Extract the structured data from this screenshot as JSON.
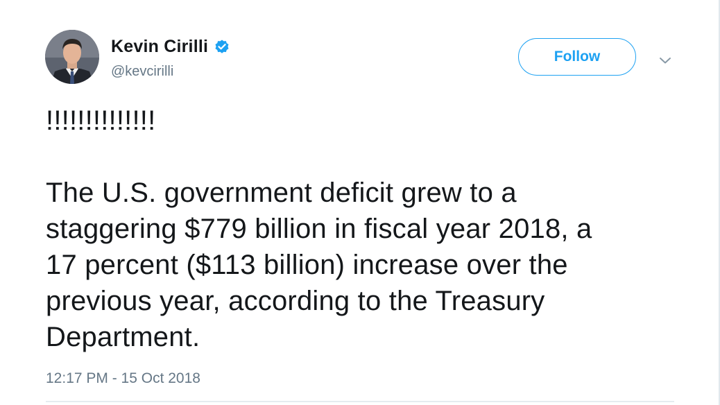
{
  "user": {
    "display_name": "Kevin Cirilli",
    "handle": "@kevcirilli",
    "verified": true
  },
  "actions": {
    "follow_label": "Follow",
    "more_icon": "chevron-down-icon"
  },
  "tweet": {
    "text": "!!!!!!!!!!!!!!\n\nThe U.S. government deficit grew to a\nstaggering $779 billion in fiscal year 2018, a\n17 percent ($113 billion) increase over the\nprevious year, according to the Treasury\nDepartment.",
    "timestamp": "12:17 PM - 15 Oct 2018"
  },
  "colors": {
    "accent": "#1da1f2",
    "text_primary": "#14171a",
    "text_secondary": "#657786"
  }
}
